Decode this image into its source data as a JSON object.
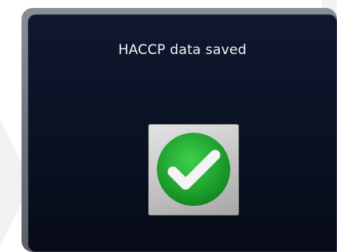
{
  "dialog": {
    "title": "HACCP data saved",
    "icon": "checkmark-success-icon"
  },
  "colors": {
    "panel_background": "#0a1122",
    "frame": "#6f747b",
    "success_green": "#1fa22e",
    "check_white": "#f4f4f4",
    "title_text": "#f2f3f5"
  }
}
